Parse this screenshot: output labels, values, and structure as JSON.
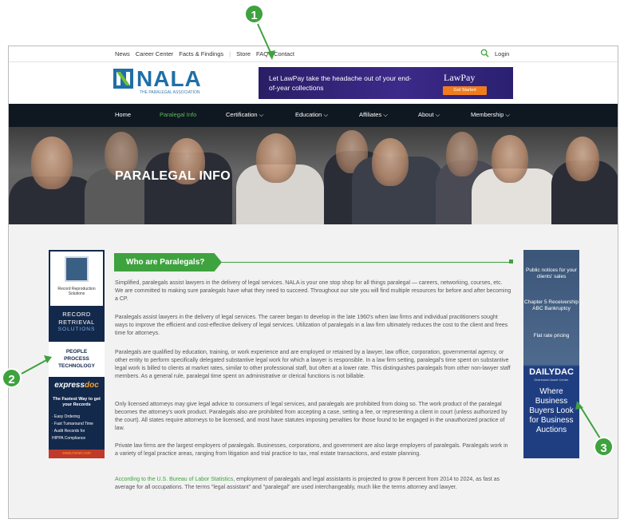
{
  "topbar": {
    "links": [
      "News",
      "Career Center",
      "Facts & Findings",
      "Store",
      "FAQ",
      "Contact"
    ],
    "login": "Login"
  },
  "header": {
    "logo_text": "NALA",
    "logo_sub": "THE PARALEGAL ASSOCIATION",
    "ad": {
      "text": "Let LawPay take the headache out of your end-of-year collections",
      "brand": "LawPay",
      "button": "Get Started"
    }
  },
  "nav": {
    "items": [
      "Home",
      "Paralegal Info",
      "Certification ⌵",
      "Education ⌵",
      "Affiliates ⌵",
      "About ⌵",
      "Membership ⌵"
    ]
  },
  "hero": {
    "title": "PARALEGAL INFO"
  },
  "left_ad": {
    "small": "Record Reproduction Solutions",
    "record": "RECORD",
    "retrieval": "RETRIEVAL",
    "solutions": "SOLUTIONS",
    "ppt": [
      "PEOPLE",
      "PROCESS",
      "TECHNOLOGY"
    ],
    "express1": "express",
    "express2": "doc",
    "fast": "The Fastest Way to get your Records",
    "list": [
      "· Easy Ordering",
      "· Fast Turnaround Time",
      "· Audit Records for",
      "  HIPPA Compliance"
    ],
    "url": "www.rrsnet.com"
  },
  "right_ad": {
    "line1": "Public notices for your clients' sales",
    "line2": "Chapter 5 Receivership ABC Bankruptcy",
    "line3": "Flat rate pricing",
    "logo": "DAILYDAC",
    "logo_sub": "Distressed Asset Center",
    "big": "Where Business Buyers Look for Business Auctions"
  },
  "content": {
    "heading": "Who are Paralegals?",
    "paragraphs": [
      "Simplified, paralegals assist lawyers in the delivery of legal services. NALA is your one stop shop for all things paralegal — careers, networking, courses, etc. We are committed to making sure paralegals have what they need to succeed. Throughout our site you will find multiple resources for before and after becoming a CP.",
      "Paralegals assist lawyers in the delivery of legal services. The career began to develop in the late 1960's when law firms and individual practitioners sought ways to improve the efficient and cost-effective delivery of legal services. Utilization of paralegals in a law firm ultimately reduces the cost to the client and frees time for attorneys.",
      "Paralegals are qualified by education, training, or work experience and are employed or retained by a lawyer, law office, corporation, governmental agency, or other entity to perform specifically delegated substantive legal work for which a lawyer is responsible. In a law firm setting, paralegal's time spent on substantive legal work is billed to clients at market rates, similar to other professional staff, but often at a lower rate. This distinguishes paralegals from other non-lawyer staff members. As a general rule, paralegal time spent on administrative or clerical functions is not billable.",
      "Only licensed attorneys may give legal advice to consumers of legal services, and paralegals are prohibited from doing so. The work product of the paralegal becomes the attorney's work product. Paralegals also are prohibited from accepting a case, setting a fee, or representing a client in court (unless authorized by the court). All states require attorneys to be licensed, and most have statutes imposing penalties for those found to be engaged in the unauthorized practice of law.",
      "Private law firms are the largest employers of paralegals. Businesses, corporations, and government are also large employers of paralegals. Paralegals work in a variety of legal practice areas, ranging from litigation and trial practice to tax, real estate transactions, and estate planning."
    ],
    "last_link": "According to the U.S. Bureau of Labor Statistics",
    "last_rest": ", employment of paralegals and legal assistants is projected to grow 8 percent from 2014 to 2024, as fast as average for all occupations. The terms \"legal assistant\" and \"paralegal\" are used interchangeably, much like the terms attorney and lawyer."
  },
  "annotations": [
    "1",
    "2",
    "3"
  ],
  "colors": {
    "accent": "#3ea23e",
    "nav_bg": "#0f1820",
    "brand": "#1f6fa8"
  }
}
